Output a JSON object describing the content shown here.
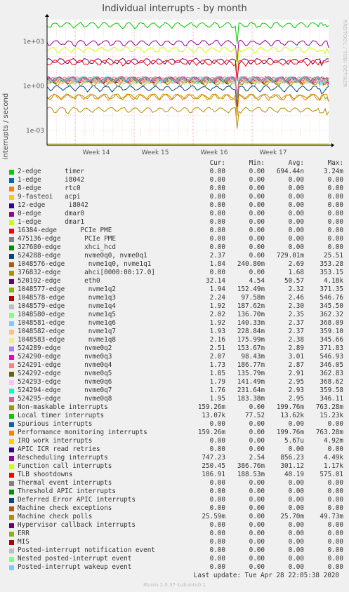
{
  "title": "Individual interrupts - by month",
  "side_label": "RRDTOOL / TOBI OETIKER",
  "footer": "Last update: Tue Apr 28 22:05:38 2020",
  "munin": "Munin 2.0.37-1ubuntu0.1",
  "headers": {
    "cur": "Cur:",
    "min": "Min:",
    "avg": "Avg:",
    "max": "Max:"
  },
  "chart_data": {
    "type": "line",
    "title": "Individual interrupts - by month",
    "ylabel": "interrupts / second",
    "yscale": "log",
    "yticks": [
      "1e+03",
      "1e+00",
      "1e-03"
    ],
    "xticks": [
      "Week 14",
      "Week 15",
      "Week 16",
      "Week 17"
    ],
    "ylim": [
      0.0001,
      30000
    ],
    "series": [
      {
        "name": "2-edge      timer",
        "color": "#00cc00",
        "cur": "0.00",
        "min": "0.00",
        "avg": "694.44n",
        "max": "3.24m"
      },
      {
        "name": "1-edge      i8042",
        "color": "#0066b3",
        "cur": "0.00",
        "min": "0.00",
        "avg": "0.00",
        "max": "0.00"
      },
      {
        "name": "8-edge      rtc0",
        "color": "#ff8000",
        "cur": "0.00",
        "min": "0.00",
        "avg": "0.00",
        "max": "0.00"
      },
      {
        "name": "9-fasteoi   acpi",
        "color": "#ffcc00",
        "cur": "0.00",
        "min": "0.00",
        "avg": "0.00",
        "max": "0.00"
      },
      {
        "name": "12-edge      i8042",
        "color": "#330099",
        "cur": "0.00",
        "min": "0.00",
        "avg": "0.00",
        "max": "0.00"
      },
      {
        "name": "0-edge      dmar0",
        "color": "#990099",
        "cur": "0.00",
        "min": "0.00",
        "avg": "0.00",
        "max": "0.00"
      },
      {
        "name": "1-edge      dmar1",
        "color": "#ccff00",
        "cur": "0.00",
        "min": "0.00",
        "avg": "0.00",
        "max": "0.00"
      },
      {
        "name": "16384-edge      PCIe PME",
        "color": "#ff0000",
        "cur": "0.00",
        "min": "0.00",
        "avg": "0.00",
        "max": "0.00"
      },
      {
        "name": "475136-edge      PCIe PME",
        "color": "#808080",
        "cur": "0.00",
        "min": "0.00",
        "avg": "0.00",
        "max": "0.00"
      },
      {
        "name": "327680-edge      xhci_hcd",
        "color": "#008f00",
        "cur": "0.00",
        "min": "0.00",
        "avg": "0.00",
        "max": "0.00"
      },
      {
        "name": "524288-edge      nvme0q0, nvme0q1",
        "color": "#00487d",
        "cur": "2.37",
        "min": "0.00",
        "avg": "729.01m",
        "max": "25.51"
      },
      {
        "name": "1048576-edge      nvme1q0, nvme1q1",
        "color": "#b35a00",
        "cur": "1.84",
        "min": "240.80m",
        "avg": "2.69",
        "max": "353.28"
      },
      {
        "name": "376832-edge      ahci[0000:00:17.0]",
        "color": "#b38f00",
        "cur": "0.00",
        "min": "0.00",
        "avg": "1.68",
        "max": "353.15"
      },
      {
        "name": "520192-edge      eth0",
        "color": "#6b006b",
        "cur": "32.14",
        "min": "4.54",
        "avg": "50.57",
        "max": "4.18k"
      },
      {
        "name": "1048577-edge      nvme1q2",
        "color": "#8fb300",
        "cur": "1.94",
        "min": "152.49m",
        "avg": "2.32",
        "max": "371.35"
      },
      {
        "name": "1048578-edge      nvme1q3",
        "color": "#b30000",
        "cur": "2.24",
        "min": "97.58m",
        "avg": "2.46",
        "max": "546.76"
      },
      {
        "name": "1048579-edge      nvme1q4",
        "color": "#bebebe",
        "cur": "1.92",
        "min": "187.62m",
        "avg": "2.30",
        "max": "345.50"
      },
      {
        "name": "1048580-edge      nvme1q5",
        "color": "#80ff80",
        "cur": "2.02",
        "min": "136.70m",
        "avg": "2.35",
        "max": "362.32"
      },
      {
        "name": "1048581-edge      nvme1q6",
        "color": "#80c9ff",
        "cur": "1.92",
        "min": "140.33m",
        "avg": "2.37",
        "max": "368.09"
      },
      {
        "name": "1048582-edge      nvme1q7",
        "color": "#ffc080",
        "cur": "1.93",
        "min": "228.84m",
        "avg": "2.37",
        "max": "359.10"
      },
      {
        "name": "1048583-edge      nvme1q8",
        "color": "#ffe680",
        "cur": "2.16",
        "min": "175.99m",
        "avg": "2.38",
        "max": "345.66"
      },
      {
        "name": "524289-edge      nvme0q2",
        "color": "#aa80ff",
        "cur": "2.51",
        "min": "153.67m",
        "avg": "2.89",
        "max": "371.83"
      },
      {
        "name": "524290-edge      nvme0q3",
        "color": "#ee00cc",
        "cur": "2.07",
        "min": "98.43m",
        "avg": "3.01",
        "max": "546.93"
      },
      {
        "name": "524291-edge      nvme0q4",
        "color": "#ff8080",
        "cur": "1.73",
        "min": "186.77m",
        "avg": "2.87",
        "max": "346.05"
      },
      {
        "name": "524292-edge      nvme0q5",
        "color": "#666600",
        "cur": "1.85",
        "min": "135.79m",
        "avg": "2.91",
        "max": "362.83"
      },
      {
        "name": "524293-edge      nvme0q6",
        "color": "#ffbfff",
        "cur": "1.79",
        "min": "141.49m",
        "avg": "2.95",
        "max": "368.62"
      },
      {
        "name": "524294-edge      nvme0q7",
        "color": "#00ffcc",
        "cur": "1.76",
        "min": "231.64m",
        "avg": "2.93",
        "max": "359.58"
      },
      {
        "name": "524295-edge      nvme0q8",
        "color": "#cc6699",
        "cur": "1.95",
        "min": "183.38m",
        "avg": "2.95",
        "max": "346.11"
      },
      {
        "name": "Non-maskable interrupts",
        "color": "#999900",
        "cur": "159.26m",
        "min": "0.00",
        "avg": "199.76m",
        "max": "763.28m"
      },
      {
        "name": "Local timer interrupts",
        "color": "#00cc00",
        "cur": "13.07k",
        "min": "77.52",
        "avg": "13.62k",
        "max": "15.23k"
      },
      {
        "name": "Spurious interrupts",
        "color": "#0066b3",
        "cur": "0.00",
        "min": "0.00",
        "avg": "0.00",
        "max": "0.00"
      },
      {
        "name": "Performance monitoring interrupts",
        "color": "#ff8000",
        "cur": "159.26m",
        "min": "0.00",
        "avg": "199.76m",
        "max": "763.28m"
      },
      {
        "name": "IRQ work interrupts",
        "color": "#ffcc00",
        "cur": "0.00",
        "min": "0.00",
        "avg": "5.67u",
        "max": "4.92m"
      },
      {
        "name": "APIC ICR read retries",
        "color": "#330099",
        "cur": "0.00",
        "min": "0.00",
        "avg": "0.00",
        "max": "0.00"
      },
      {
        "name": "Rescheduling interrupts",
        "color": "#990099",
        "cur": "747.23",
        "min": "2.54",
        "avg": "856.23",
        "max": "4.49k"
      },
      {
        "name": "Function call interrupts",
        "color": "#ccff00",
        "cur": "250.45",
        "min": "386.76m",
        "avg": "301.12",
        "max": "1.17k"
      },
      {
        "name": "TLB shootdowns",
        "color": "#ff0000",
        "cur": "106.91",
        "min": "188.53m",
        "avg": "40.19",
        "max": "575.01"
      },
      {
        "name": "Thermal event interrupts",
        "color": "#808080",
        "cur": "0.00",
        "min": "0.00",
        "avg": "0.00",
        "max": "0.00"
      },
      {
        "name": "Threshold APIC interrupts",
        "color": "#008f00",
        "cur": "0.00",
        "min": "0.00",
        "avg": "0.00",
        "max": "0.00"
      },
      {
        "name": "Deferred Error APIC interrupts",
        "color": "#00487d",
        "cur": "0.00",
        "min": "0.00",
        "avg": "0.00",
        "max": "0.00"
      },
      {
        "name": "Machine check exceptions",
        "color": "#b35a00",
        "cur": "0.00",
        "min": "0.00",
        "avg": "0.00",
        "max": "0.00"
      },
      {
        "name": "Machine check polls",
        "color": "#b38f00",
        "cur": "25.59m",
        "min": "0.00",
        "avg": "25.70m",
        "max": "49.73m"
      },
      {
        "name": "Hypervisor callback interrupts",
        "color": "#6b006b",
        "cur": "0.00",
        "min": "0.00",
        "avg": "0.00",
        "max": "0.00"
      },
      {
        "name": "ERR",
        "color": "#8fb300",
        "cur": "0.00",
        "min": "0.00",
        "avg": "0.00",
        "max": "0.00"
      },
      {
        "name": "MIS",
        "color": "#b30000",
        "cur": "0.00",
        "min": "0.00",
        "avg": "0.00",
        "max": "0.00"
      },
      {
        "name": "Posted-interrupt notification event",
        "color": "#bebebe",
        "cur": "0.00",
        "min": "0.00",
        "avg": "0.00",
        "max": "0.00"
      },
      {
        "name": "Nested posted-interrupt event",
        "color": "#80ff80",
        "cur": "0.00",
        "min": "0.00",
        "avg": "0.00",
        "max": "0.00"
      },
      {
        "name": "Posted-interrupt wakeup event",
        "color": "#80c9ff",
        "cur": "0.00",
        "min": "0.00",
        "avg": "0.00",
        "max": "0.00"
      }
    ]
  }
}
